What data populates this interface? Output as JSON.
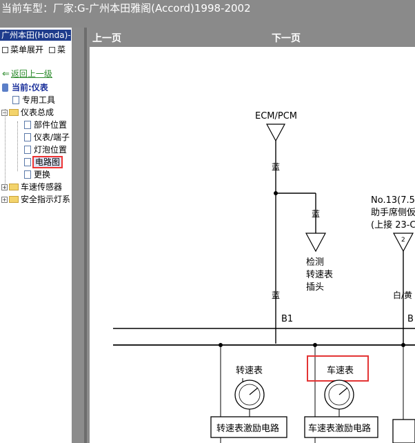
{
  "title": "当前车型：厂家:G-广州本田雅阁(Accord)1998-2002",
  "sidebar": {
    "brand": "广州本田(Honda)-",
    "expand": "菜单展开",
    "collapse": "菜",
    "back": "返回上一级",
    "current": "当前:仪表",
    "items": [
      {
        "label": "专用工具"
      },
      {
        "label": "仪表总成"
      },
      {
        "label": "部件位置"
      },
      {
        "label": "仪表/端子"
      },
      {
        "label": "灯泡位置"
      },
      {
        "label": "电路图"
      },
      {
        "label": "更换"
      },
      {
        "label": "车速传感器"
      },
      {
        "label": "安全指示灯系"
      }
    ]
  },
  "nav": {
    "prev": "上一页",
    "next": "下一页"
  },
  "diagram": {
    "ecm": "ECM/PCM",
    "blue1": "蓝",
    "blue2": "蓝",
    "blue3": "蓝",
    "detect1": "检测",
    "detect2": "转速表",
    "detect3": "插头",
    "fuse1": "No.13(7.5",
    "fuse2": "助手席侧仮",
    "fuse3": "(上接 23-C",
    "fuse_num": "2",
    "white_yellow": "白/黄",
    "b1": "B1",
    "b_right": "B",
    "tach": "转速表",
    "speedo": "车速表",
    "tach_drive": "转速表激励电路",
    "speedo_drive": "车速表激励电路"
  },
  "colors": {
    "selection": "#e33333",
    "titlebar": "#8a8a8a",
    "brand": "#1e3c8c"
  }
}
